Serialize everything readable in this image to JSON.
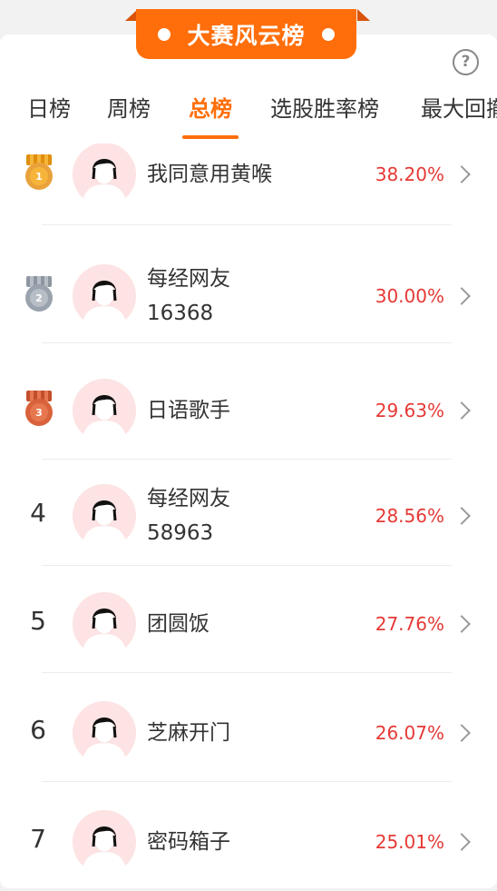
{
  "banner": {
    "title": "大赛风云榜"
  },
  "help": {
    "label": "?"
  },
  "tabs": [
    {
      "label": "日榜",
      "active": false
    },
    {
      "label": "周榜",
      "active": false
    },
    {
      "label": "总榜",
      "active": true
    },
    {
      "label": "选股胜率榜",
      "active": false
    },
    {
      "label": "最大回撤",
      "active": false
    }
  ],
  "leaderboard": [
    {
      "rank": "1",
      "medal": "gold-medal-icon",
      "name_line1": "我同意用黄喉",
      "name_line2": "",
      "rate": "38.20%"
    },
    {
      "rank": "2",
      "medal": "silver-medal-icon",
      "name_line1": "每经网友",
      "name_line2": "16368",
      "rate": "30.00%"
    },
    {
      "rank": "3",
      "medal": "bronze-medal-icon",
      "name_line1": "日语歌手",
      "name_line2": "",
      "rate": "29.63%"
    },
    {
      "rank": "4",
      "medal": "",
      "name_line1": "每经网友",
      "name_line2": "58963",
      "rate": "28.56%"
    },
    {
      "rank": "5",
      "medal": "",
      "name_line1": "团圆饭",
      "name_line2": "",
      "rate": "27.76%"
    },
    {
      "rank": "6",
      "medal": "",
      "name_line1": "芝麻开门",
      "name_line2": "",
      "rate": "26.07%"
    },
    {
      "rank": "7",
      "medal": "",
      "name_line1": "密码箱子",
      "name_line2": "",
      "rate": "25.01%"
    }
  ],
  "colors": {
    "accent": "#ff6e0a",
    "rate": "#e53935",
    "gold": "#f5a623",
    "silver": "#9aa3ad",
    "bronze": "#d9623b"
  }
}
